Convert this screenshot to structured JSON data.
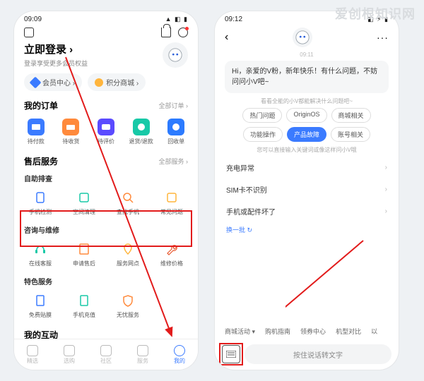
{
  "watermark": "爱创根知识网",
  "phone1": {
    "status_time": "09:09",
    "login_title": "立即登录 ›",
    "login_sub": "登录享受更多会员权益",
    "pills": {
      "member": "会员中心 ›",
      "points": "积分商城 ›"
    },
    "orders": {
      "title": "我的订单",
      "link": "全部订单 ›",
      "items": [
        "待付款",
        "待收货",
        "待评价",
        "退货/退款",
        "回收单"
      ]
    },
    "after": {
      "title": "售后服务",
      "link": "全部服务 ›",
      "g1_title": "自助排查",
      "g1": [
        "手机检测",
        "空间清理",
        "查找手机",
        "常见问题"
      ],
      "g2_title": "咨询与维修",
      "g2": [
        "在线客服",
        "申请售后",
        "服务网点",
        "维修价格"
      ],
      "g3_title": "特色服务",
      "g3": [
        "免费贴膜",
        "手机充值",
        "无忧服务"
      ]
    },
    "interact_title": "我的互动",
    "tabs": [
      "精选",
      "选购",
      "社区",
      "服务",
      "我的"
    ]
  },
  "phone2": {
    "status_time": "09:12",
    "msg_time": "09:11",
    "greeting": "Hi，亲爱的V粉，新年快乐！有什么问题，不妨问问小V吧~",
    "hint1": "看看全能的小V都能解决什么问题吧~",
    "chips": [
      "热门问题",
      "OriginOS",
      "商城相关",
      "功能操作",
      "产品故障",
      "账号相关"
    ],
    "active_chip_index": 4,
    "hint2": "您可以直接输入关键词或像这样问小V哦",
    "list": [
      "充电异常",
      "SIM卡不识别",
      "手机或配件坏了"
    ],
    "refresh": "换一批 ↻",
    "suggestions": [
      "商城活动 ▾",
      "购机指南",
      "领券中心",
      "机型对比",
      "以"
    ],
    "voice_placeholder": "按住说话转文字"
  }
}
